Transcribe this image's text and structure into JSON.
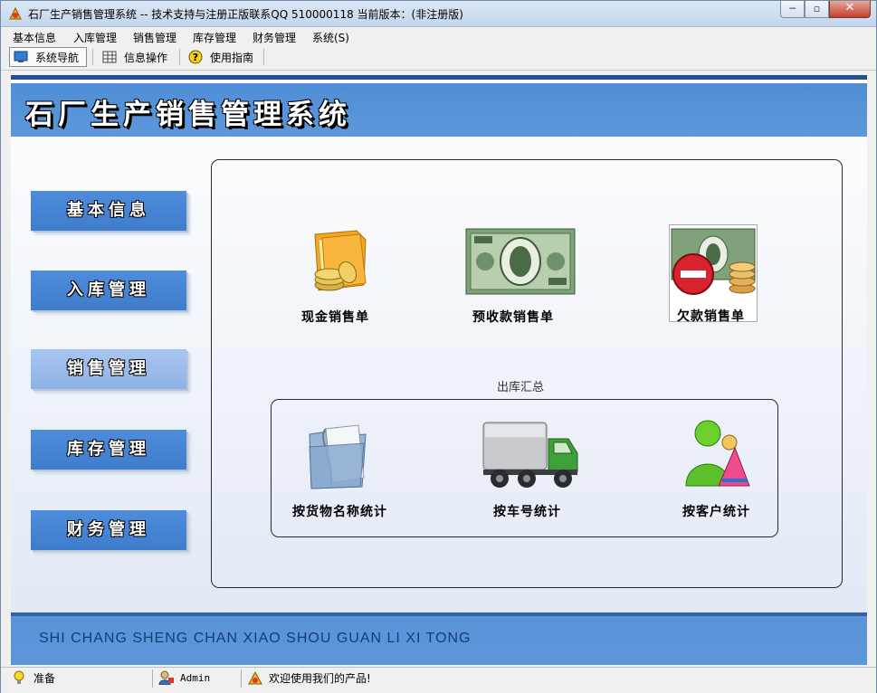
{
  "window": {
    "title": "石厂生产销售管理系统 -- 技术支持与注册正版联系QQ 510000118   当前版本：(非注册版)",
    "controls": {
      "minimize": "─",
      "maximize": "▫",
      "close": "✕"
    }
  },
  "menu": [
    "基本信息",
    "入库管理",
    "销售管理",
    "库存管理",
    "财务管理",
    "系统(S)"
  ],
  "toolbar": {
    "tabs": [
      {
        "label": "系统导航",
        "icon": "monitor-icon",
        "active": true
      },
      {
        "label": "信息操作",
        "icon": "grid-icon",
        "active": false
      },
      {
        "label": "使用指南",
        "icon": "help-icon",
        "active": false
      }
    ]
  },
  "banner": {
    "title": "石厂生产销售管理系统"
  },
  "nav": [
    {
      "label": "基本信息",
      "selected": false
    },
    {
      "label": "入库管理",
      "selected": false
    },
    {
      "label": "销售管理",
      "selected": true
    },
    {
      "label": "库存管理",
      "selected": false
    },
    {
      "label": "财务管理",
      "selected": false
    }
  ],
  "sales_tiles": [
    {
      "label": "现金销售单",
      "icon": "cash-folder-icon"
    },
    {
      "label": "预收款销售单",
      "icon": "banknote-icon"
    },
    {
      "label": "欠款销售单",
      "icon": "debt-banknote-icon"
    }
  ],
  "outbound": {
    "group_label": "出库汇总",
    "tiles": [
      {
        "label": "按货物名称统计",
        "icon": "document-folder-icon"
      },
      {
        "label": "按车号统计",
        "icon": "truck-icon"
      },
      {
        "label": "按客户统计",
        "icon": "customer-icon"
      }
    ]
  },
  "footer": {
    "text": "SHI CHANG SHENG CHAN XIAO SHOU GUAN LI XI TONG"
  },
  "status": {
    "ready": "准备",
    "user": "Admin",
    "welcome": "欢迎使用我们的产品!"
  },
  "colors": {
    "banner_blue": "#5e97da",
    "nav_blue": "#3f7ccc",
    "nav_selected": "#a9c6f0",
    "footer_text": "#123e78"
  }
}
